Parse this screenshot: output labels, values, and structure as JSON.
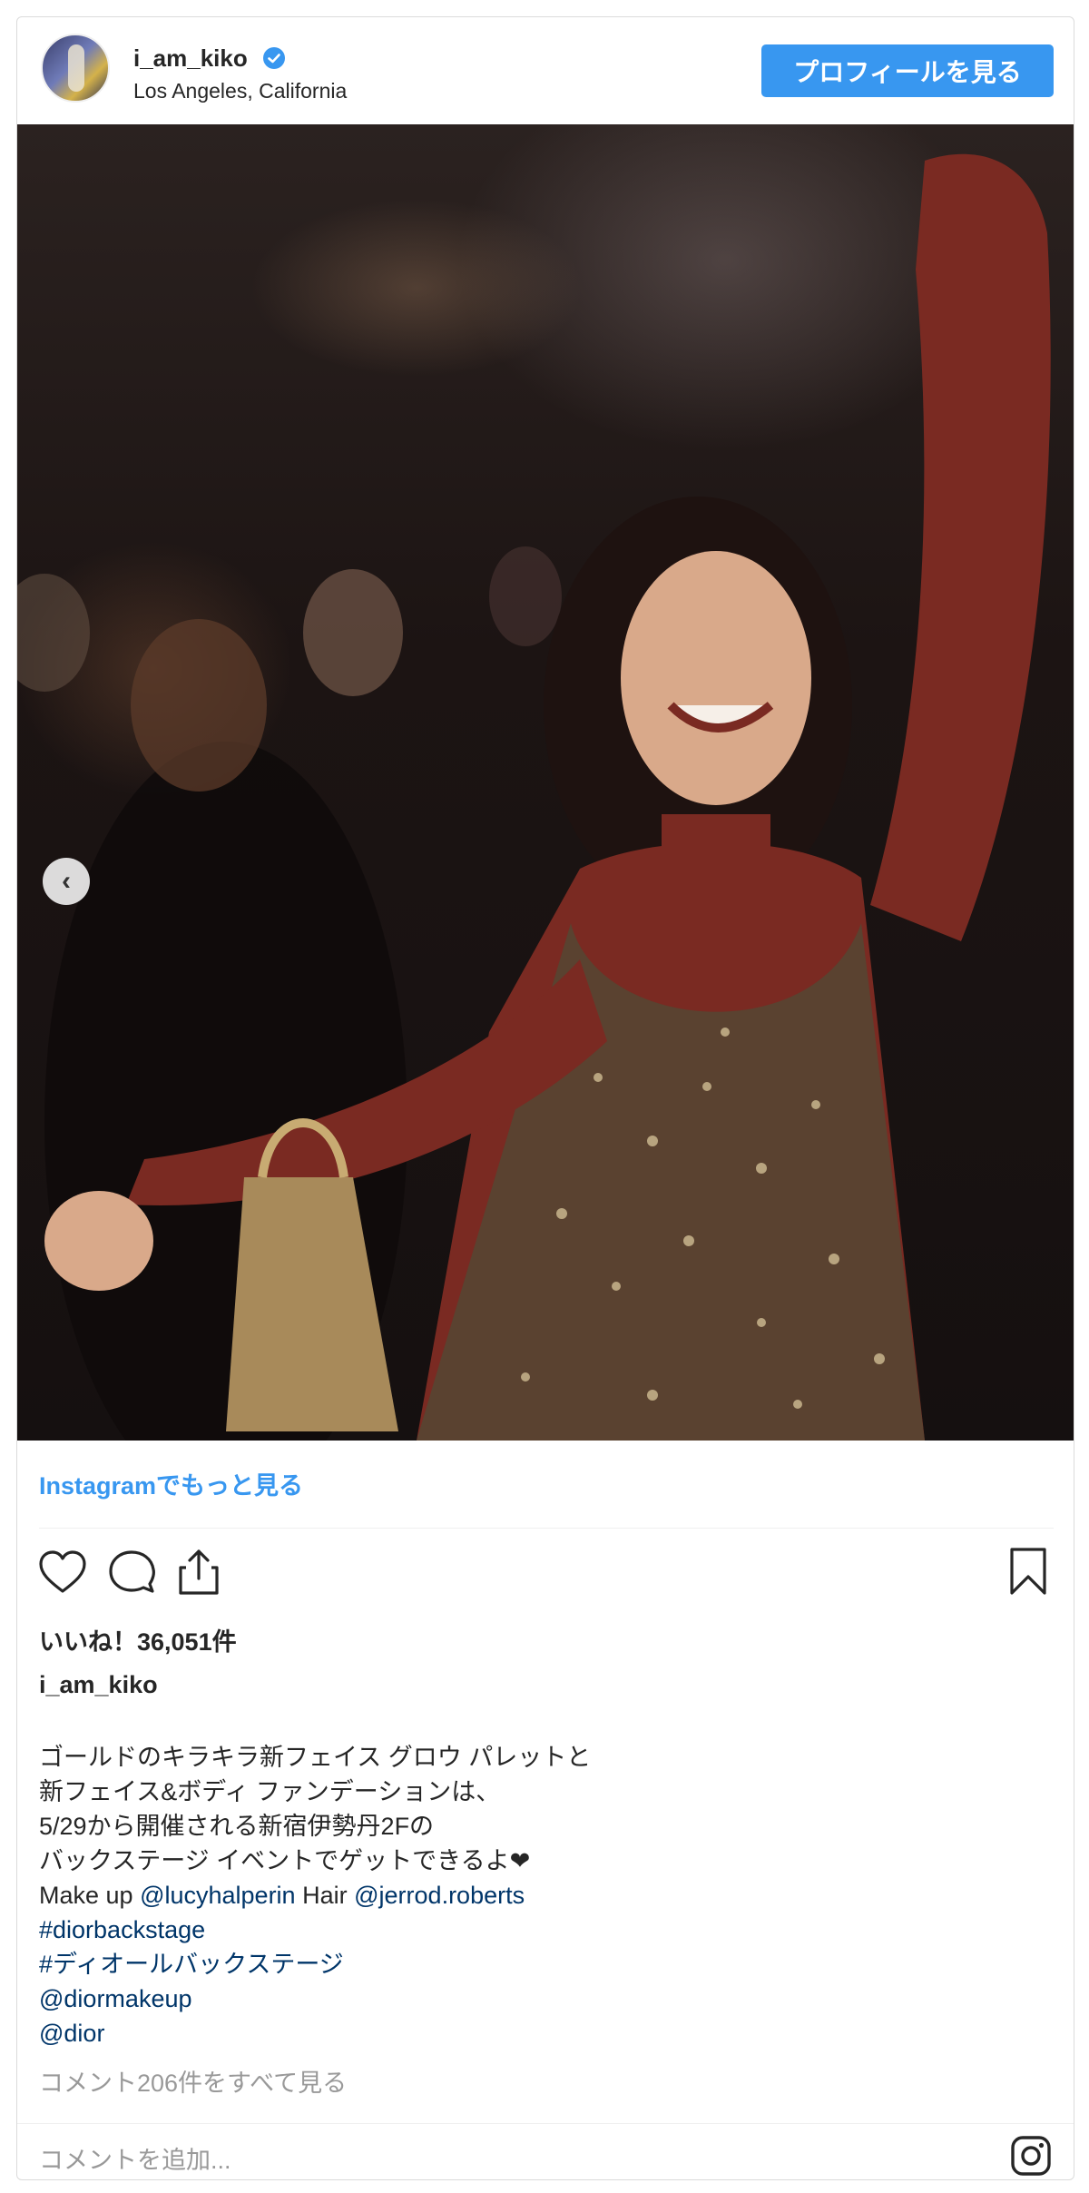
{
  "header": {
    "username": "i_am_kiko",
    "location": "Los Angeles, California",
    "follow_label": "プロフィールを見る"
  },
  "photo": {
    "alt": "",
    "carousel_prev": "‹"
  },
  "more_link": "Instagramでもっと見る",
  "likes": "いいね！36,051件",
  "poster": "i_am_kiko",
  "caption": {
    "line1": "ゴールドのキラキラ新フェイス グロウ パレットと",
    "line2": "新フェイス&ボディ ファンデーションは、",
    "line3": "5/29から開催される新宿伊勢丹2Fの",
    "line4": "バックステージ イベントでゲットできるよ❤",
    "makeup_label": "Make up",
    "makeup_handle": "@lucyhalperin",
    "hair_label": "Hair",
    "hair_handle": "@jerrod.roberts",
    "tag1": "#diorbackstage",
    "tag2": "#ディオールバックステージ",
    "mention1": "@diormakeup",
    "mention2": "@dior"
  },
  "comments_link": "コメント206件をすべて見る",
  "comment_placeholder": "コメントを追加...",
  "colors": {
    "accent": "#3897f0",
    "link": "#003569",
    "muted": "#999999"
  },
  "icons": [
    "verified-badge-icon",
    "heart-icon",
    "comment-icon",
    "share-icon",
    "bookmark-icon",
    "instagram-logo-icon",
    "chevron-left-icon"
  ]
}
